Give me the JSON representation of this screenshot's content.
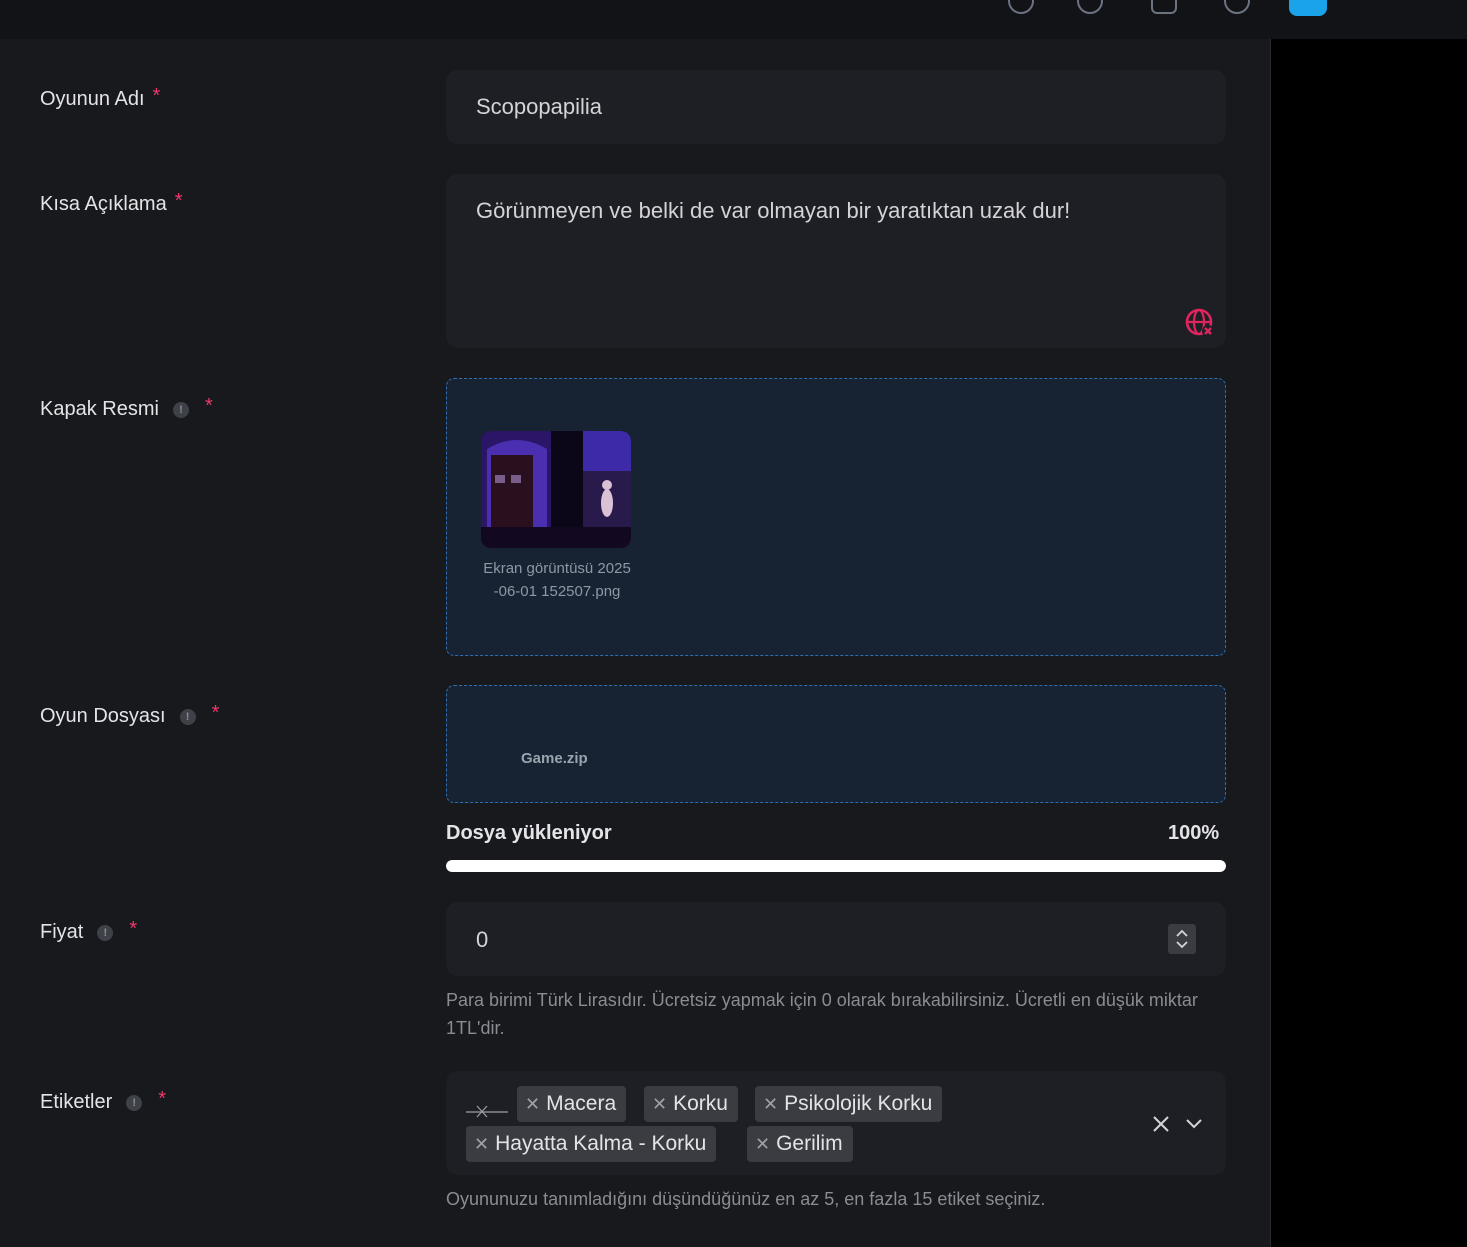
{
  "form": {
    "name": {
      "label": "Oyunun Adı",
      "required": "*",
      "value": "Scopopapilia"
    },
    "short_desc": {
      "label": "Kısa Açıklama",
      "required": "*",
      "value": "Görünmeyen ve belki de var olmayan bir yaratıktan uzak dur!"
    },
    "cover": {
      "label": "Kapak Resmi",
      "info": "!",
      "required": "*",
      "file_name": "Ekran görüntüsü 2025-06-01 152507.png"
    },
    "game_file": {
      "label": "Oyun Dosyası",
      "info": "!",
      "required": "*",
      "file_name": "Game.zip",
      "upload_label": "Dosya yükleniyor",
      "upload_percent_text": "100%",
      "upload_fraction": 1.0
    },
    "price": {
      "label": "Fiyat",
      "info": "!",
      "required": "*",
      "value": "0",
      "help": "Para birimi Türk Lirasıdır. Ücretsiz yapmak için 0 olarak bırakabilirsiniz. Ücretli en düşük miktar 1TL'dir."
    },
    "tags": {
      "label": "Etiketler",
      "info": "!",
      "required": "*",
      "chips": [
        "Macera",
        "Korku",
        "Psikolojik Korku",
        "Hayatta Kalma - Korku",
        "Gerilim"
      ],
      "help": "Oyununuzu tanımladığını düşündüğünüz en az 5, en fazla 15 etiket seçiniz."
    }
  },
  "icons": {
    "translate_off": "globe-off-icon",
    "remove": "close-icon",
    "dropdown": "chevron-down-icon",
    "spinner": "updown-icon"
  },
  "colors": {
    "accent_required": "#f0386b",
    "dropzone_border": "#2f6fb0",
    "avatar": "#1aa3e8"
  }
}
